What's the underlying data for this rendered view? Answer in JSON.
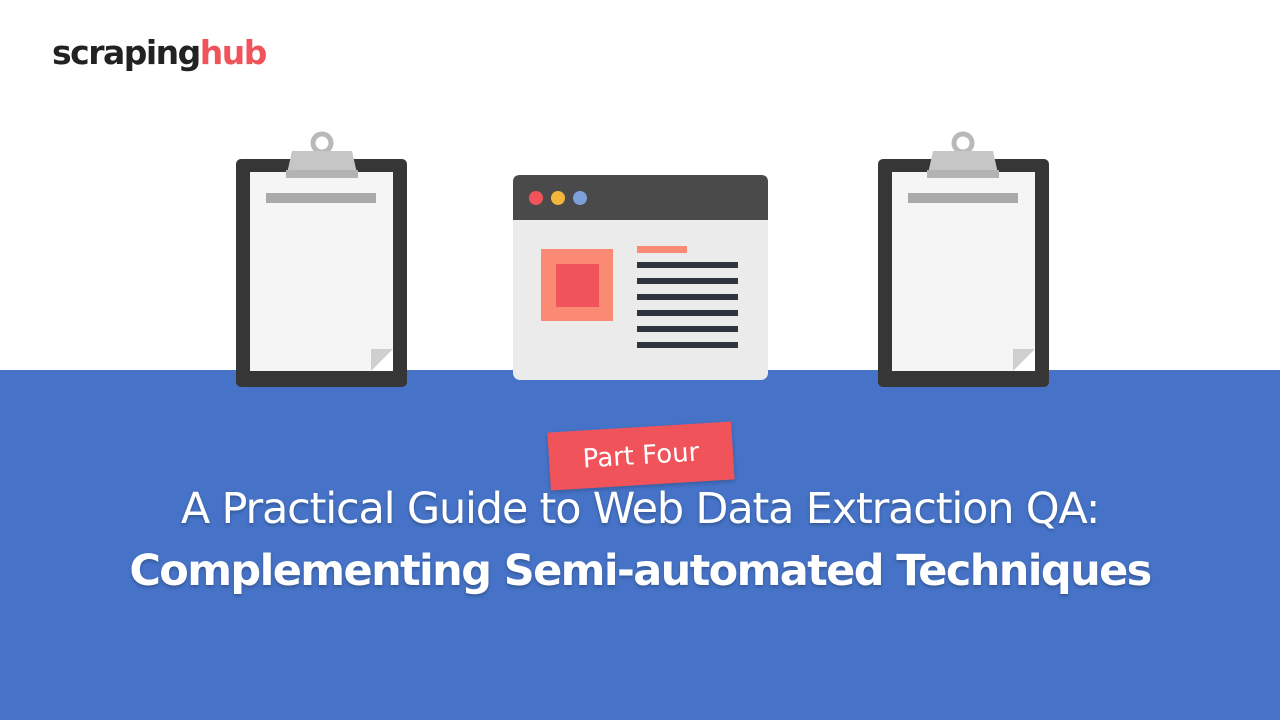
{
  "logo": {
    "part1": "scraping",
    "part2": "hub"
  },
  "badge": {
    "label": "Part Four"
  },
  "headline": {
    "line1": "A Practical Guide to Web Data Extraction QA:",
    "line2": "Complementing Semi-automated Techniques"
  },
  "colors": {
    "band": "#4673c7",
    "accent": "#f0545a",
    "clipboard_frame": "#363636",
    "clip": "#c6c6c6",
    "browser_bar": "#4a4a4a",
    "browser_body": "#ebebeb",
    "dot_red": "#f0545a",
    "dot_yellow": "#f2b63b",
    "dot_blue": "#7ca0db"
  },
  "icons": [
    "clipboard-icon",
    "browser-window-icon",
    "clipboard-icon"
  ]
}
